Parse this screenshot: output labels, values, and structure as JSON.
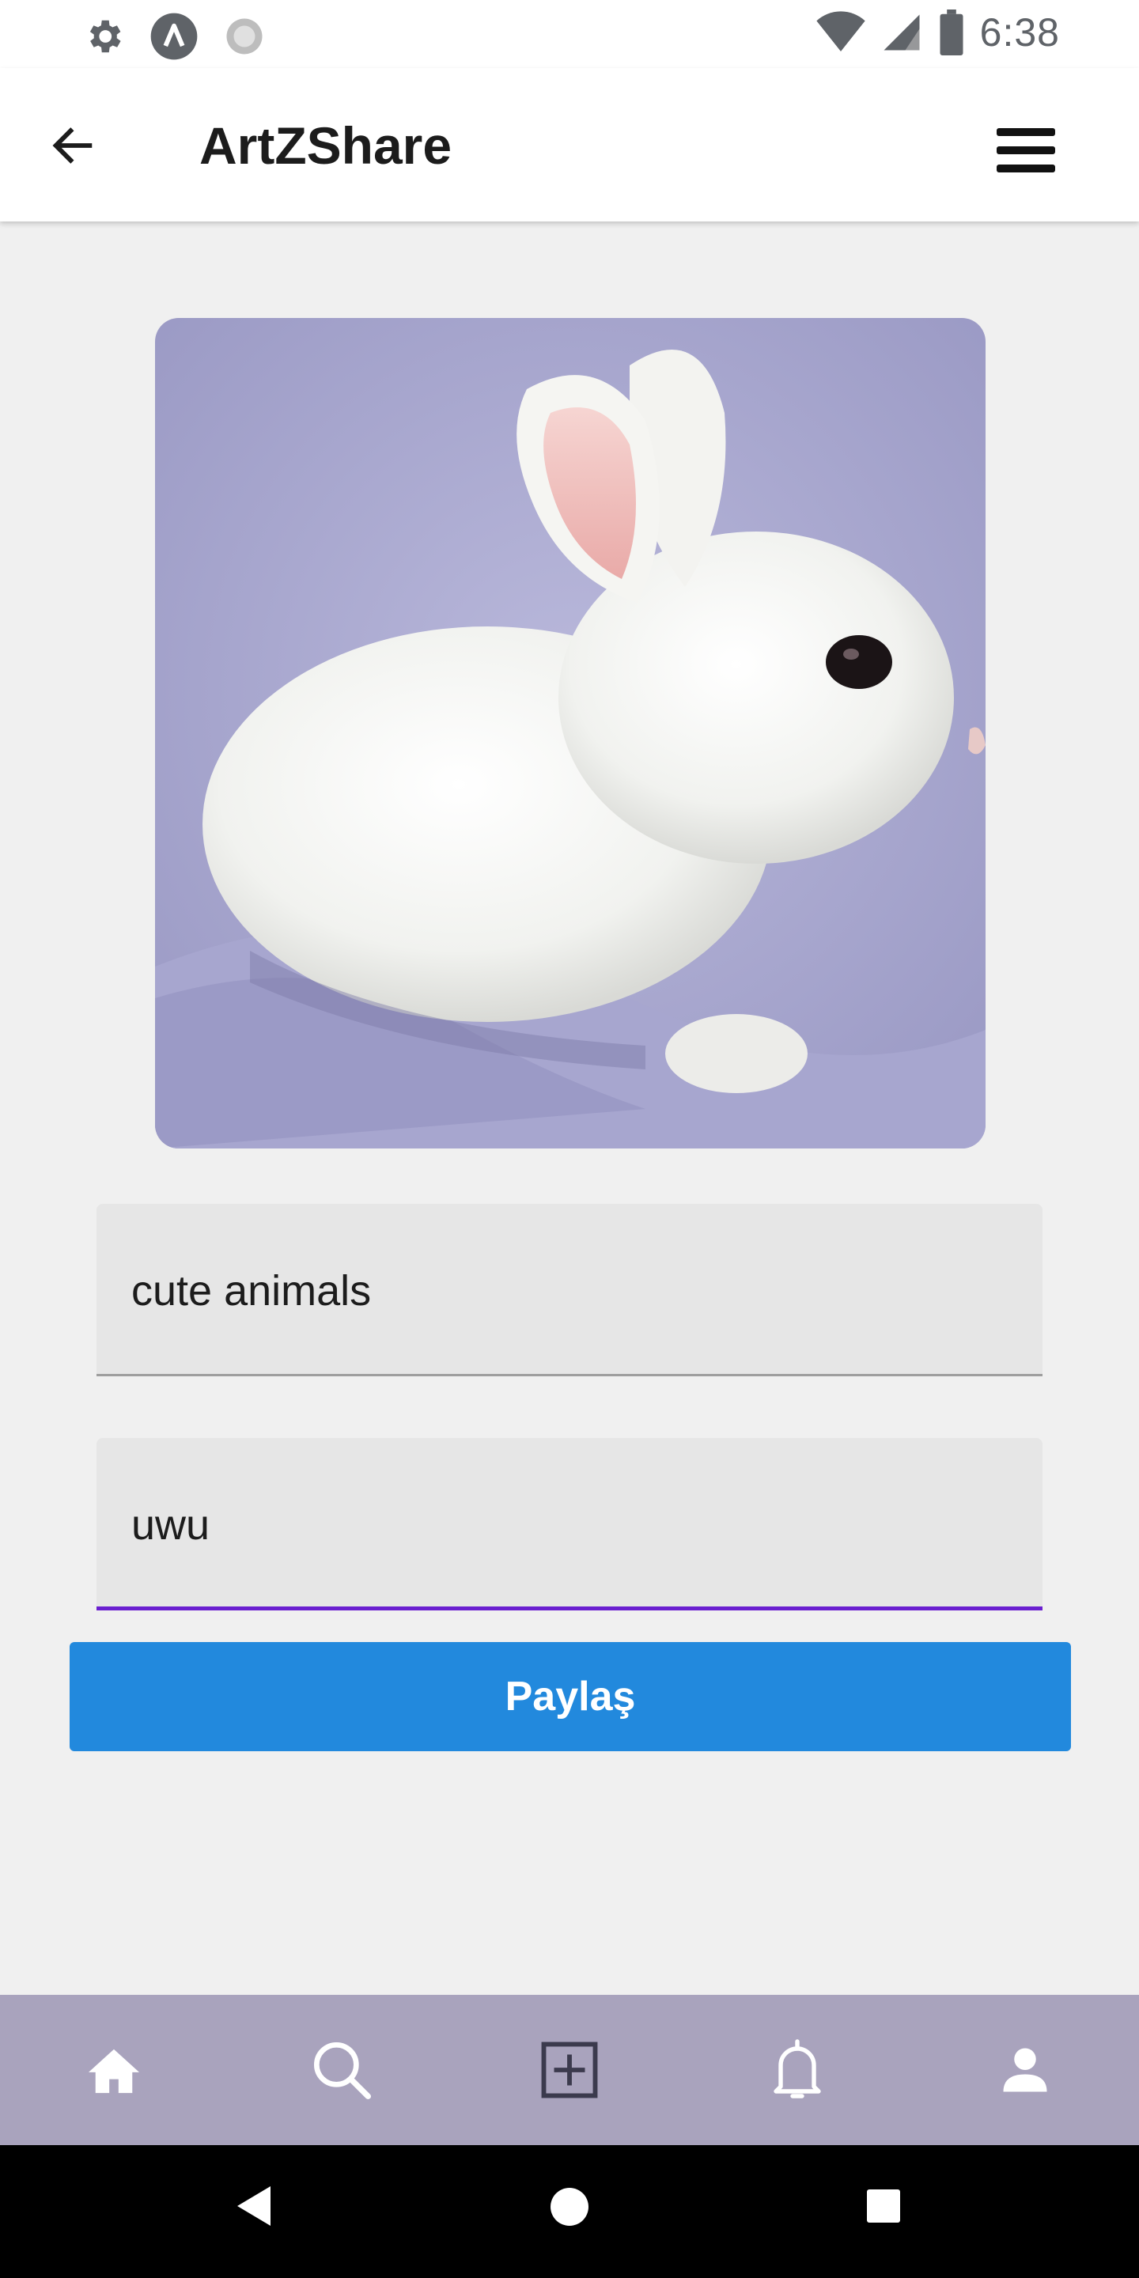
{
  "status_bar": {
    "time": "6:38",
    "left_icons": [
      "gear-icon",
      "app-a-icon",
      "sync-icon"
    ],
    "right_icons": [
      "wifi-icon",
      "signal-icon",
      "battery-icon"
    ]
  },
  "app_bar": {
    "title": "ArtZShare",
    "back_icon": "arrow-left-icon",
    "menu_icon": "hamburger-menu-icon"
  },
  "post": {
    "image_description": "white-rabbit-photo"
  },
  "form": {
    "field_1_value": "cute animals",
    "field_2_value": "uwu",
    "share_label": "Paylaş"
  },
  "bottom_nav": {
    "items": [
      {
        "icon": "home-icon"
      },
      {
        "icon": "search-icon"
      },
      {
        "icon": "add-square-icon"
      },
      {
        "icon": "bell-icon"
      },
      {
        "icon": "person-icon"
      }
    ]
  },
  "colors": {
    "accent": "#6a1fd0",
    "button": "#2289dd",
    "bottom_nav_bg": "#a9a3bd"
  }
}
